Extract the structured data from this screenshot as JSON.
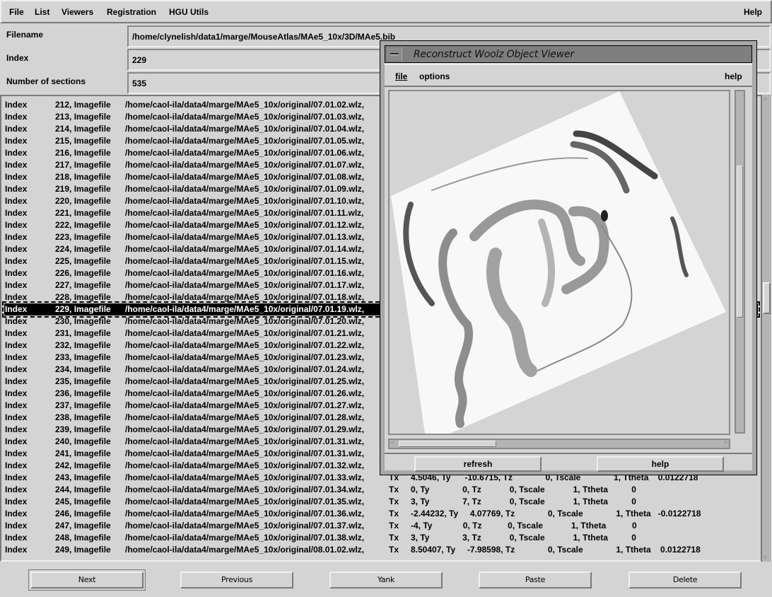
{
  "menubar": {
    "items": [
      {
        "label": "File",
        "mnemonic": "F"
      },
      {
        "label": "List",
        "mnemonic": "L"
      },
      {
        "label": "Viewers",
        "mnemonic": "V"
      },
      {
        "label": "Registration",
        "mnemonic": "R"
      },
      {
        "label": "HGU Utils",
        "mnemonic": ""
      }
    ],
    "help": "Help"
  },
  "form": {
    "filename_label": "Filename",
    "filename_value": "/home/clynelish/data1/marge/MouseAtlas/MAe5_10x/3D/MAe5.bib",
    "index_label": "Index",
    "index_value": "229",
    "sections_label": "Number of sections",
    "sections_value": "535"
  },
  "list": {
    "selected_index": 229,
    "rows": [
      {
        "label": "Index",
        "idx": "212, Imagefile",
        "path": "/home/caol-ila/data4/marge/MAe5_10x/original/07.01.02.wlz,"
      },
      {
        "label": "Index",
        "idx": "213, Imagefile",
        "path": "/home/caol-ila/data4/marge/MAe5_10x/original/07.01.03.wlz,"
      },
      {
        "label": "Index",
        "idx": "214, Imagefile",
        "path": "/home/caol-ila/data4/marge/MAe5_10x/original/07.01.04.wlz,"
      },
      {
        "label": "Index",
        "idx": "215, Imagefile",
        "path": "/home/caol-ila/data4/marge/MAe5_10x/original/07.01.05.wlz,"
      },
      {
        "label": "Index",
        "idx": "216, Imagefile",
        "path": "/home/caol-ila/data4/marge/MAe5_10x/original/07.01.06.wlz,"
      },
      {
        "label": "Index",
        "idx": "217, Imagefile",
        "path": "/home/caol-ila/data4/marge/MAe5_10x/original/07.01.07.wlz,"
      },
      {
        "label": "Index",
        "idx": "218, Imagefile",
        "path": "/home/caol-ila/data4/marge/MAe5_10x/original/07.01.08.wlz,"
      },
      {
        "label": "Index",
        "idx": "219, Imagefile",
        "path": "/home/caol-ila/data4/marge/MAe5_10x/original/07.01.09.wlz,"
      },
      {
        "label": "Index",
        "idx": "220, Imagefile",
        "path": "/home/caol-ila/data4/marge/MAe5_10x/original/07.01.10.wlz,"
      },
      {
        "label": "Index",
        "idx": "221, Imagefile",
        "path": "/home/caol-ila/data4/marge/MAe5_10x/original/07.01.11.wlz,"
      },
      {
        "label": "Index",
        "idx": "222, Imagefile",
        "path": "/home/caol-ila/data4/marge/MAe5_10x/original/07.01.12.wlz,"
      },
      {
        "label": "Index",
        "idx": "223, Imagefile",
        "path": "/home/caol-ila/data4/marge/MAe5_10x/original/07.01.13.wlz,"
      },
      {
        "label": "Index",
        "idx": "224, Imagefile",
        "path": "/home/caol-ila/data4/marge/MAe5_10x/original/07.01.14.wlz,"
      },
      {
        "label": "Index",
        "idx": "225, Imagefile",
        "path": "/home/caol-ila/data4/marge/MAe5_10x/original/07.01.15.wlz,"
      },
      {
        "label": "Index",
        "idx": "226, Imagefile",
        "path": "/home/caol-ila/data4/marge/MAe5_10x/original/07.01.16.wlz,"
      },
      {
        "label": "Index",
        "idx": "227, Imagefile",
        "path": "/home/caol-ila/data4/marge/MAe5_10x/original/07.01.17.wlz,"
      },
      {
        "label": "Index",
        "idx": "228, Imagefile",
        "path": "/home/caol-ila/data4/marge/MAe5_10x/original/07.01.18.wlz,"
      },
      {
        "label": "Index",
        "idx": "229, Imagefile",
        "path": "/home/caol-ila/data4/marge/MAe5_10x/original/07.01.19.wlz,"
      },
      {
        "label": "Index",
        "idx": "230, Imagefile",
        "path": "/home/caol-ila/data4/marge/MAe5_10x/original/07.01.20.wlz,"
      },
      {
        "label": "Index",
        "idx": "231, Imagefile",
        "path": "/home/caol-ila/data4/marge/MAe5_10x/original/07.01.21.wlz,"
      },
      {
        "label": "Index",
        "idx": "232, Imagefile",
        "path": "/home/caol-ila/data4/marge/MAe5_10x/original/07.01.22.wlz,"
      },
      {
        "label": "Index",
        "idx": "233, Imagefile",
        "path": "/home/caol-ila/data4/marge/MAe5_10x/original/07.01.23.wlz,"
      },
      {
        "label": "Index",
        "idx": "234, Imagefile",
        "path": "/home/caol-ila/data4/marge/MAe5_10x/original/07.01.24.wlz,"
      },
      {
        "label": "Index",
        "idx": "235, Imagefile",
        "path": "/home/caol-ila/data4/marge/MAe5_10x/original/07.01.25.wlz,"
      },
      {
        "label": "Index",
        "idx": "236, Imagefile",
        "path": "/home/caol-ila/data4/marge/MAe5_10x/original/07.01.26.wlz,"
      },
      {
        "label": "Index",
        "idx": "237, Imagefile",
        "path": "/home/caol-ila/data4/marge/MAe5_10x/original/07.01.27.wlz,"
      },
      {
        "label": "Index",
        "idx": "238, Imagefile",
        "path": "/home/caol-ila/data4/marge/MAe5_10x/original/07.01.28.wlz,"
      },
      {
        "label": "Index",
        "idx": "239, Imagefile",
        "path": "/home/caol-ila/data4/marge/MAe5_10x/original/07.01.29.wlz,"
      },
      {
        "label": "Index",
        "idx": "240, Imagefile",
        "path": "/home/caol-ila/data4/marge/MAe5_10x/original/07.01.31.wlz,"
      },
      {
        "label": "Index",
        "idx": "241, Imagefile",
        "path": "/home/caol-ila/data4/marge/MAe5_10x/original/07.01.31.wlz,"
      },
      {
        "label": "Index",
        "idx": "242, Imagefile",
        "path": "/home/caol-ila/data4/marge/MAe5_10x/original/07.01.32.wlz,"
      },
      {
        "label": "Index",
        "idx": "243, Imagefile",
        "path": "/home/caol-ila/data4/marge/MAe5_10x/original/07.01.33.wlz,",
        "tx": "Tx",
        "tail": "4.5046, Ty      -10.6715, Tz              0, Tscale              1, Ttheta    0.0122718"
      },
      {
        "label": "Index",
        "idx": "244, Imagefile",
        "path": "/home/caol-ila/data4/marge/MAe5_10x/original/07.01.34.wlz,",
        "tx": "Tx",
        "tail": "0, Ty              0, Tz            0, Tscale            1, Ttheta          0"
      },
      {
        "label": "Index",
        "idx": "245, Imagefile",
        "path": "/home/caol-ila/data4/marge/MAe5_10x/original/07.01.35.wlz,",
        "tx": "Tx",
        "tail": "3, Ty              7, Tz            0, Tscale            1, Ttheta          0"
      },
      {
        "label": "Index",
        "idx": "246, Imagefile",
        "path": "/home/caol-ila/data4/marge/MAe5_10x/original/07.01.36.wlz,",
        "tx": "Tx",
        "tail": "-2.44232, Ty     4.07769, Tz              0, Tscale              1, Ttheta   -0.0122718"
      },
      {
        "label": "Index",
        "idx": "247, Imagefile",
        "path": "/home/caol-ila/data4/marge/MAe5_10x/original/07.01.37.wlz,",
        "tx": "Tx",
        "tail": "-4, Ty             0, Tz           0, Tscale            1, Ttheta           0"
      },
      {
        "label": "Index",
        "idx": "248, Imagefile",
        "path": "/home/caol-ila/data4/marge/MAe5_10x/original/07.01.38.wlz,",
        "tx": "Tx",
        "tail": "3, Ty              3, Tz            0, Tscale            1, Ttheta          0"
      },
      {
        "label": "Index",
        "idx": "249, Imagefile",
        "path": "/home/caol-ila/data4/marge/MAe5_10x/original/08.01.02.wlz,",
        "tx": "Tx",
        "tail": "8.50407, Ty     -7.98598, Tz              0, Tscale              1, Ttheta    0.0122718"
      }
    ]
  },
  "buttons": {
    "next": "Next",
    "previous": "Previous",
    "yank": "Yank",
    "paste": "Paste",
    "delete": "Delete"
  },
  "viewer": {
    "title": "Reconstruct Woolz Object Viewer",
    "menu": {
      "file": "file",
      "options": "options",
      "help": "help"
    },
    "refresh": "refresh",
    "help_button": "help"
  },
  "icons": {
    "window-menu": "window-menu-icon",
    "arrow-up": "▵",
    "arrow-down": "▿",
    "arrow-left": "◃",
    "arrow-right": "▹"
  }
}
